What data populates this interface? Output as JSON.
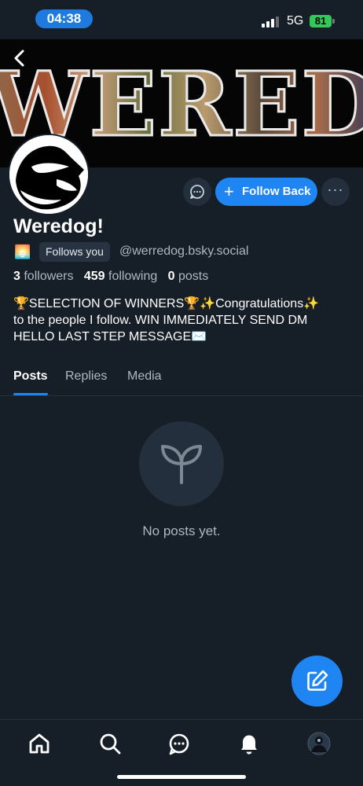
{
  "status_bar": {
    "time": "04:38",
    "network": "5G",
    "battery": "81"
  },
  "banner": {
    "text": "WEREDO"
  },
  "profile": {
    "display_name": "Weredog!",
    "follows_you": "Follows you",
    "handle": "@werredog.bsky.social",
    "followers_count": "3",
    "followers_label": "followers",
    "following_count": "459",
    "following_label": "following",
    "posts_count": "0",
    "posts_label": "posts",
    "bio_line1": "🏆SELECTION OF WINNERS🏆✨Congratulations✨",
    "bio_line2": "to the people I follow. WIN IMMEDIATELY SEND DM",
    "bio_line3": "HELLO LAST STEP MESSAGE✉️"
  },
  "actions": {
    "follow_back": "Follow Back",
    "more": "···"
  },
  "tabs": [
    {
      "label": "Posts",
      "active": true
    },
    {
      "label": "Replies",
      "active": false
    },
    {
      "label": "Media",
      "active": false
    }
  ],
  "empty_state": {
    "message": "No posts yet."
  },
  "colors": {
    "background": "#161e27",
    "accent": "#1e85f2",
    "surface": "#232f3c",
    "muted_text": "#aeb8c2",
    "battery": "#34c759"
  },
  "icons": {
    "back": "chevron-left-icon",
    "message": "chat-bubble-icon",
    "compose": "compose-icon",
    "empty": "sprout-icon",
    "nav": [
      "home-icon",
      "search-icon",
      "chat-icon",
      "bell-icon",
      "profile-avatar"
    ]
  }
}
